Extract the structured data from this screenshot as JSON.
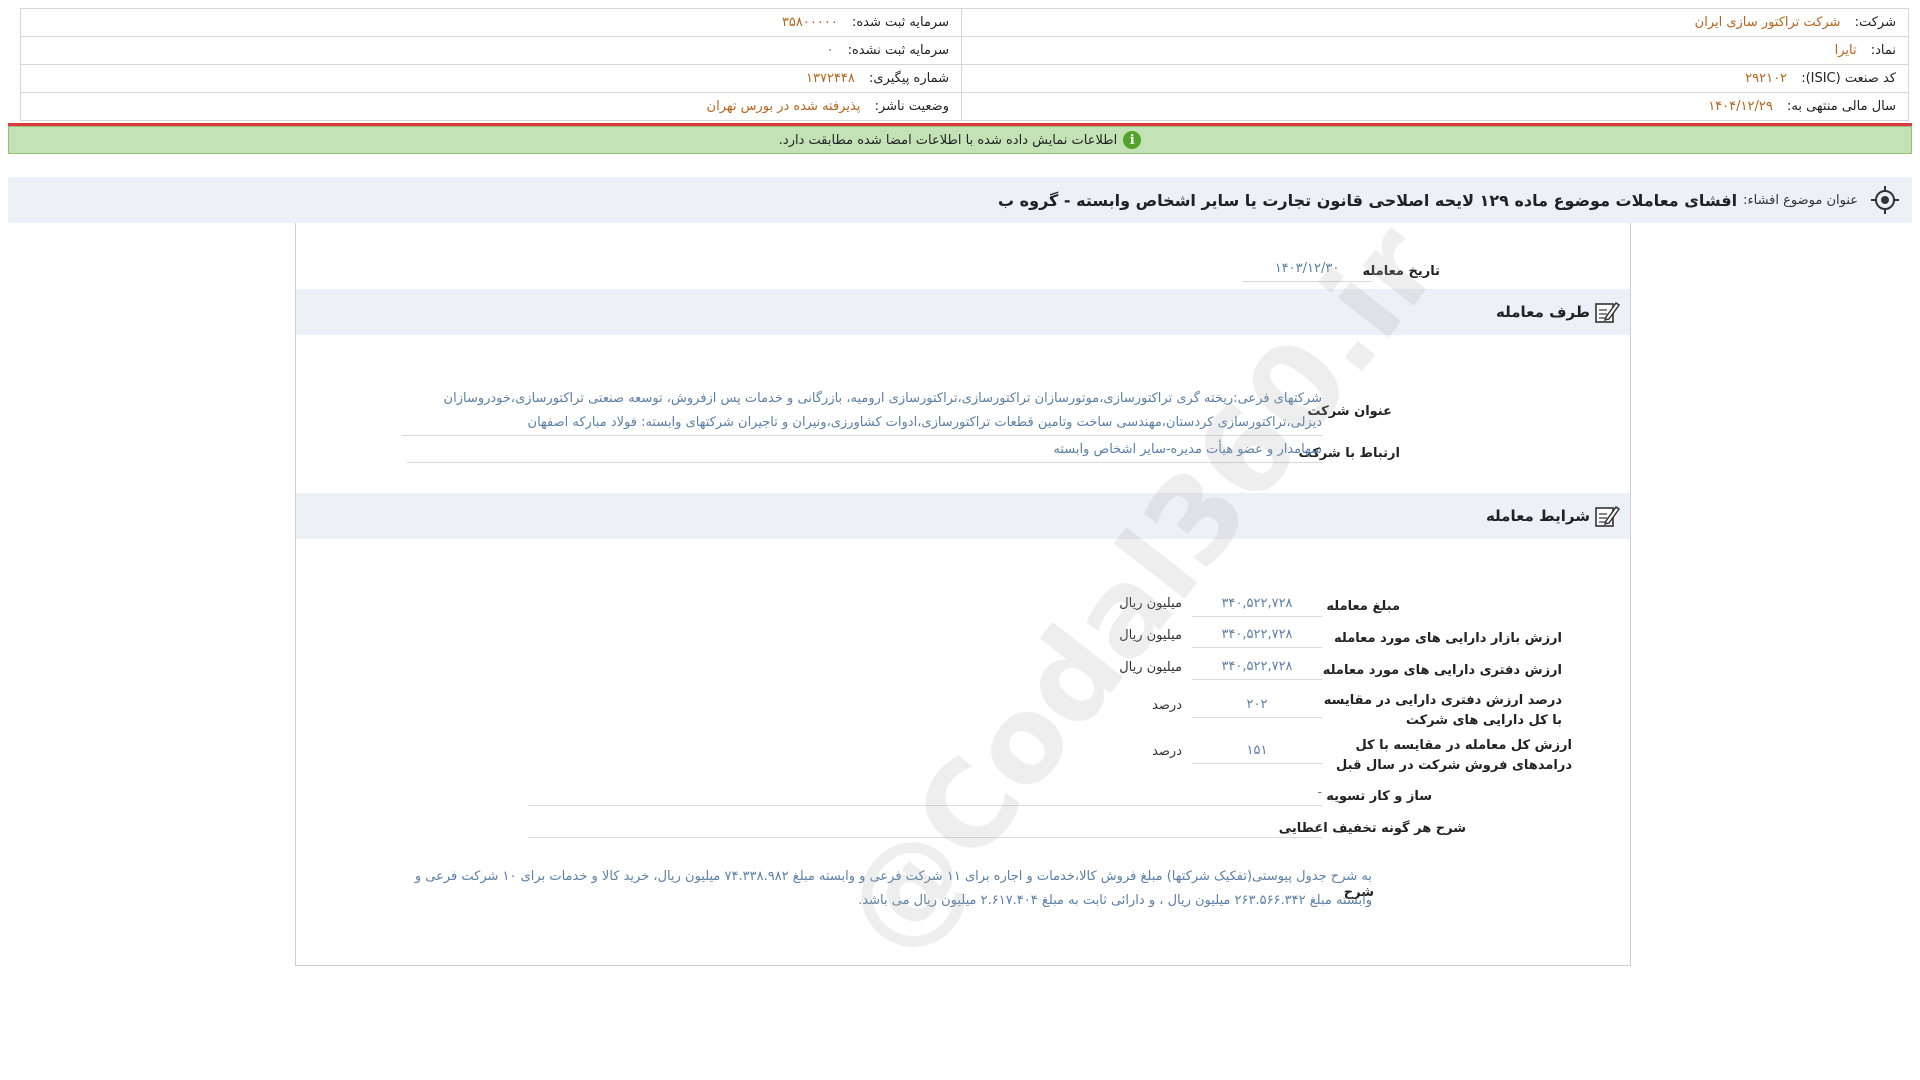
{
  "header": {
    "company_label": "شرکت:",
    "company_value": "شرکت تراکتور سازی ایران",
    "registered_capital_label": "سرمایه ثبت شده:",
    "registered_capital_value": "۳۵۸۰۰۰۰۰",
    "symbol_label": "نماد:",
    "symbol_value": "تایرا",
    "unregistered_capital_label": "سرمایه ثبت نشده:",
    "unregistered_capital_value": "۰",
    "isic_label": "کد صنعت (ISIC):",
    "isic_value": "۲۹۲۱۰۲",
    "tracking_label": "شماره پیگیری:",
    "tracking_value": "۱۳۷۲۴۴۸",
    "fiscal_year_label": "سال مالی منتهی به:",
    "fiscal_year_value": "۱۴۰۴/۱۲/۲۹",
    "publisher_status_label": "وضعیت ناشر:",
    "publisher_status_value": "پذیرفته شده در بورس تهران"
  },
  "notice": {
    "icon": "info-icon",
    "text": "اطلاعات نمایش داده شده با اطلاعات امضا شده مطابقت دارد."
  },
  "title_bar": {
    "label": "عنوان موضوع افشاء:",
    "text": "افشای معاملات موضوع ماده ۱۲۹ لایحه اصلاحی قانون تجارت یا سایر اشخاص وابسته - گروه ب"
  },
  "transaction_date": {
    "label": "تاریخ معامله",
    "value": "۱۴۰۳/۱۲/۳۰"
  },
  "party_section": {
    "title": "طرف معامله",
    "company_title_label": "عنوان شرکت",
    "company_title_value": "شرکتهای فرعی:ریخته گری تراکتورسازی،موتورسازان تراکتورسازی،تراکتورسازی ارومیه، بازرگانی و خدمات پس ازفروش، توسعه صنعتی تراکتورسازی،خودروسازان دیزلی،تراکتورسازی کردستان،مهندسی ساخت وتامین قطعات تراکتورسازی،ادوات کشاورزی،ونیران و تاجیران شرکتهای وابسته: فولاد مبارکه اصفهان",
    "relation_label": "ارتباط با شرکت",
    "relation_value": "سهامدار و عضو هیأت مدیره-سایر اشخاص وابسته"
  },
  "conditions_section": {
    "title": "شرایط معامله",
    "rows": [
      {
        "label": "مبلغ معامله",
        "value": "۳۴۰,۵۲۲,۷۲۸",
        "unit": "میلیون ریال"
      },
      {
        "label": "ارزش بازار دارایی های مورد معامله",
        "value": "۳۴۰,۵۲۲,۷۲۸",
        "unit": "میلیون ریال"
      },
      {
        "label": "ارزش دفتری دارایی های مورد معامله",
        "value": "۳۴۰,۵۲۲,۷۲۸",
        "unit": "میلیون ریال"
      },
      {
        "label": "درصد ارزش دفتری دارایی در مقایسه با کل دارایی های شرکت",
        "value": "۲۰۲",
        "unit": "درصد"
      },
      {
        "label": "ارزش کل معامله در مقایسه با کل درامدهای فروش شرکت در سال قبل",
        "value": "۱۵۱",
        "unit": "درصد"
      }
    ],
    "settlement_label": "ساز و کار تسویه",
    "settlement_value": "-",
    "discount_label": "شرح هر گونه تخفیف اعطایی",
    "discount_value": "-",
    "description_label": "شرح",
    "description_value": "به شرح جدول پیوستی(تفکیک شرکتها) مبلغ فروش کالا،خدمات و اجاره برای ۱۱ شرکت فرعی و وابسته مبلغ ۷۴.۳۳۸.۹۸۲ میلیون ریال، خرید کالا و خدمات برای ۱۰ شرکت فرعی و وابسته مبلغ ۲۶۳.۵۶۶.۳۴۲ میلیون ریال ، و دارائی ثابت به مبلغ ۲.۶۱۷.۴۰۴ میلیون ریال می باشد."
  },
  "watermark": "@Codal360.ir",
  "colors": {
    "value_orange": "#b5651d",
    "value_blue": "#5b7fa6",
    "notice_green": "#c3e3b6",
    "accent_red": "#e0383e",
    "section_bg": "#ecf1f7"
  }
}
